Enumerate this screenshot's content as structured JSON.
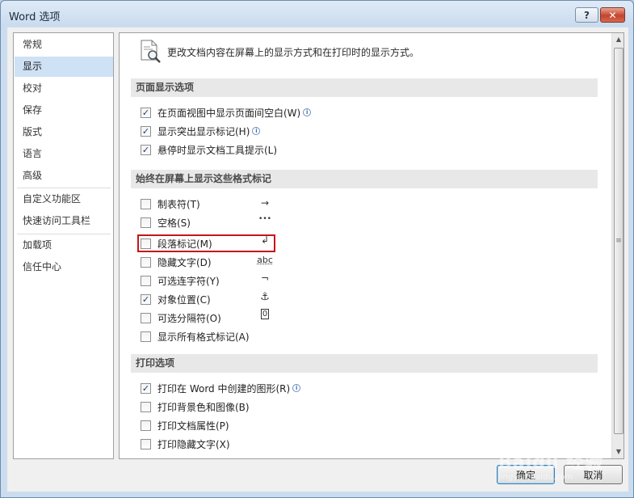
{
  "window": {
    "title": "Word 选项",
    "help_label": "?",
    "close_label": "✕"
  },
  "sidebar": {
    "items": [
      {
        "label": "常规"
      },
      {
        "label": "显示",
        "active": true
      },
      {
        "label": "校对"
      },
      {
        "label": "保存"
      },
      {
        "label": "版式"
      },
      {
        "label": "语言"
      },
      {
        "label": "高级"
      },
      {
        "label": "自定义功能区"
      },
      {
        "label": "快速访问工具栏"
      },
      {
        "label": "加载项"
      },
      {
        "label": "信任中心"
      }
    ]
  },
  "header": {
    "text": "更改文档内容在屏幕上的显示方式和在打印时的显示方式。",
    "icon": "document-magnifier-icon"
  },
  "sections": {
    "page_display": {
      "title": "页面显示选项",
      "options": [
        {
          "label": "在页面视图中显示页面间空白(W)",
          "checked": true,
          "info": true
        },
        {
          "label": "显示突出显示标记(H)",
          "checked": true,
          "info": true
        },
        {
          "label": "悬停时显示文档工具提示(L)",
          "checked": true,
          "info": false
        }
      ]
    },
    "format_marks": {
      "title": "始终在屏幕上显示这些格式标记",
      "options": [
        {
          "label": "制表符(T)",
          "checked": false,
          "symbol": "→"
        },
        {
          "label": "空格(S)",
          "checked": false,
          "symbol": "•••"
        },
        {
          "label": "段落标记(M)",
          "checked": false,
          "symbol": "↲"
        },
        {
          "label": "隐藏文字(D)",
          "checked": false,
          "symbol": "abc"
        },
        {
          "label": "可选连字符(Y)",
          "checked": false,
          "symbol": "¬"
        },
        {
          "label": "对象位置(C)",
          "checked": true,
          "symbol": "⚓"
        },
        {
          "label": "可选分隔符(O)",
          "checked": false,
          "symbol": "0"
        },
        {
          "label": "显示所有格式标记(A)",
          "checked": false,
          "symbol": ""
        }
      ]
    },
    "print": {
      "title": "打印选项",
      "options": [
        {
          "label": "打印在 Word 中创建的图形(R)",
          "checked": true,
          "info": true
        },
        {
          "label": "打印背景色和图像(B)",
          "checked": false,
          "info": false
        },
        {
          "label": "打印文档属性(P)",
          "checked": false,
          "info": false
        },
        {
          "label": "打印隐藏文字(X)",
          "checked": false,
          "info": false
        }
      ]
    }
  },
  "checkmark": "✓",
  "info_glyph": "i",
  "scroll": {
    "up": "▲",
    "down": "▼",
    "grip": "≡"
  },
  "buttons": {
    "ok": "确定",
    "cancel": "取消"
  },
  "watermark": {
    "text": "Baidu 经验",
    "sub": "jingyan.baidu.com"
  },
  "colors": {
    "selected_nav": "#cfe1f5",
    "highlight_box": "#c4161c",
    "section_bg": "#e8e8e8"
  }
}
